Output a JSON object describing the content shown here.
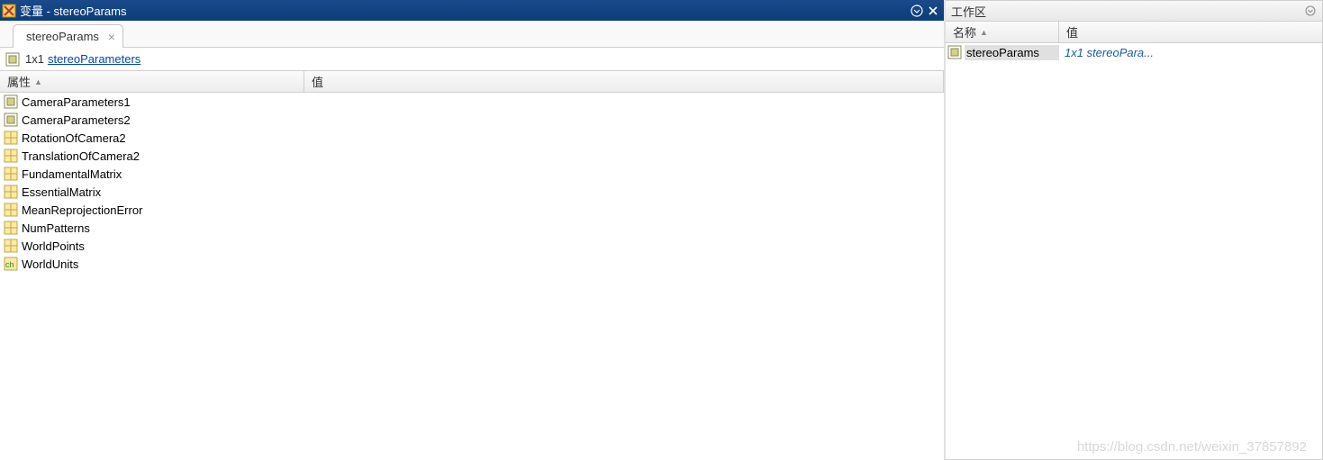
{
  "titlebar": {
    "title": "变量 - stereoParams"
  },
  "tab": {
    "label": "stereoParams"
  },
  "breadcrumb": {
    "size_label": "1x1",
    "type_link": "stereoParameters"
  },
  "columns": {
    "attr": "属性",
    "val": "值"
  },
  "properties": [
    {
      "name": "CameraParameters1",
      "icon": "cube"
    },
    {
      "name": "CameraParameters2",
      "icon": "cube"
    },
    {
      "name": "RotationOfCamera2",
      "icon": "grid"
    },
    {
      "name": "TranslationOfCamera2",
      "icon": "grid"
    },
    {
      "name": "FundamentalMatrix",
      "icon": "grid"
    },
    {
      "name": "EssentialMatrix",
      "icon": "grid"
    },
    {
      "name": "MeanReprojectionError",
      "icon": "grid"
    },
    {
      "name": "NumPatterns",
      "icon": "grid"
    },
    {
      "name": "WorldPoints",
      "icon": "grid"
    },
    {
      "name": "WorldUnits",
      "icon": "char"
    }
  ],
  "workspace": {
    "title": "工作区",
    "columns": {
      "name": "名称",
      "val": "值"
    },
    "row": {
      "name": "stereoParams",
      "value": "1x1 stereoPara..."
    }
  },
  "watermark": "https://blog.csdn.net/weixin_37857892"
}
